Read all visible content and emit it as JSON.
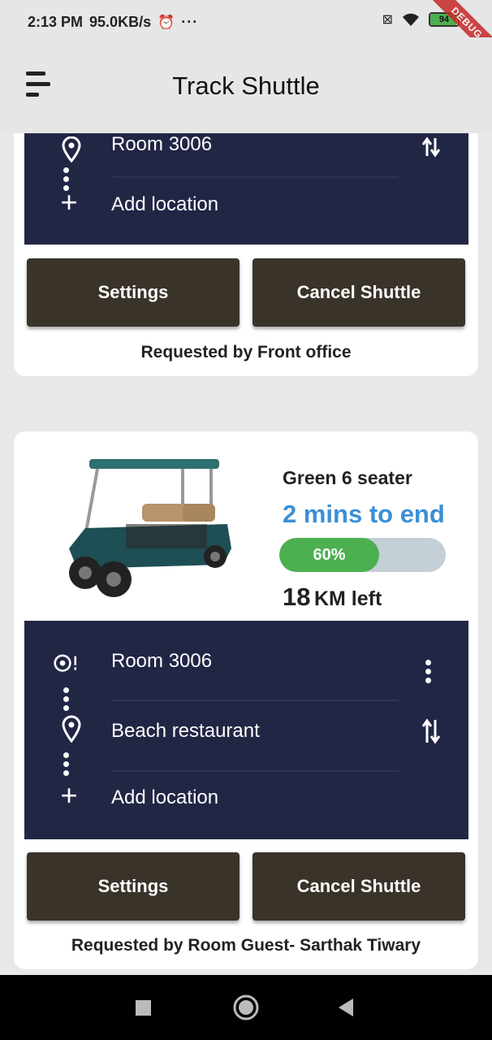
{
  "status_bar": {
    "time": "2:13 PM",
    "speed": "95.0KB/s",
    "alarm_icon": "alarm-icon",
    "more": "···",
    "battery": "94",
    "debug": "DEBUG"
  },
  "app_bar": {
    "title": "Track Shuttle",
    "menu_icon": "menu-icon"
  },
  "cards": [
    {
      "route": [
        {
          "label": "Room 3006",
          "icon": "location-pin-icon",
          "action_icon": "swap-vert-icon"
        },
        {
          "label": "Add location",
          "icon": "plus-icon"
        }
      ],
      "settings_label": "Settings",
      "cancel_label": "Cancel Shuttle",
      "requested_by": "Requested by Front office"
    },
    {
      "vehicle_name": "Green 6 seater",
      "eta": "2 mins to end",
      "progress_pct": 60,
      "progress_label": "60%",
      "km_number": "18",
      "km_unit": "KM left",
      "route": [
        {
          "label": "Room 3006",
          "icon": "target-pin-icon",
          "action_icon": "more-vert-icon"
        },
        {
          "label": "Beach restaurant",
          "icon": "location-pin-icon",
          "action_icon": "swap-vert-icon"
        },
        {
          "label": "Add location",
          "icon": "plus-icon"
        }
      ],
      "settings_label": "Settings",
      "cancel_label": "Cancel Shuttle",
      "requested_by": "Requested by Room Guest- Sarthak Tiwary"
    }
  ],
  "accent_color": "#3a8fd6",
  "route_panel_color": "#222645",
  "button_color": "#3a332a"
}
